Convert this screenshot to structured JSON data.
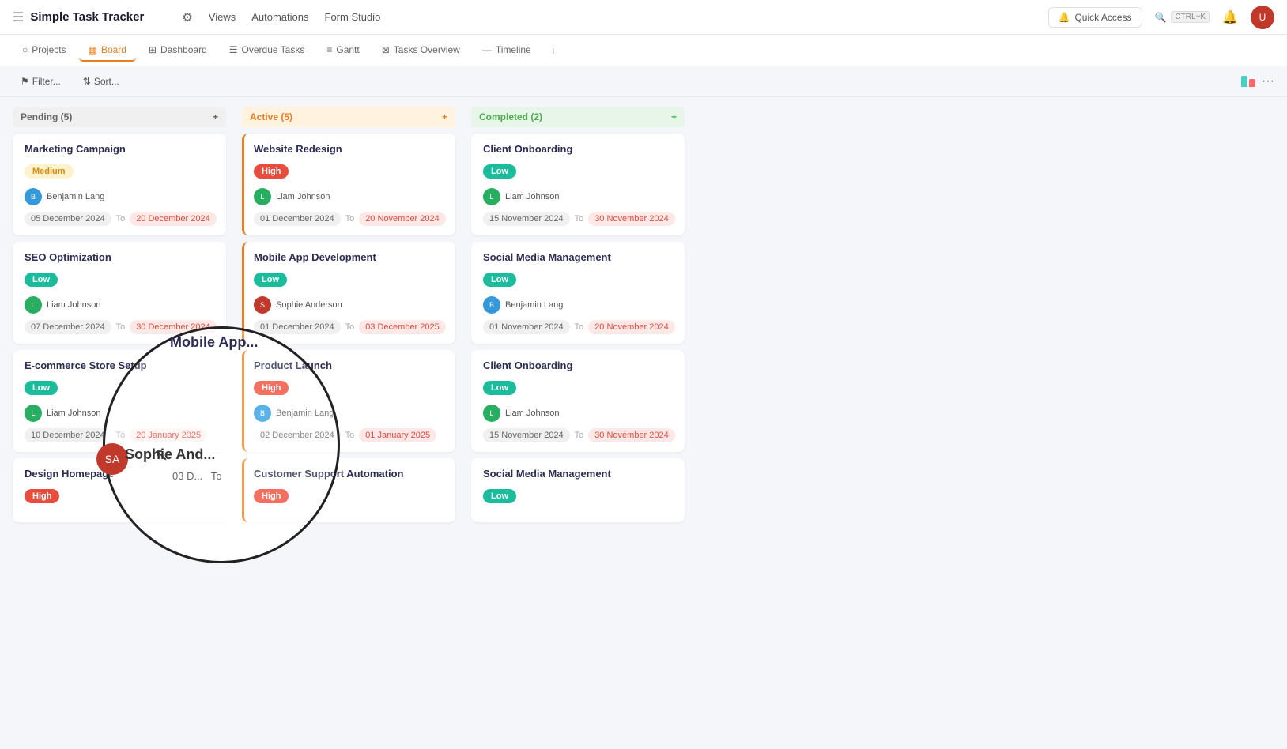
{
  "app": {
    "title": "Simple Task Tracker",
    "menu_icon": "☰"
  },
  "navbar": {
    "settings_icon": "⚙",
    "views_label": "Views",
    "automations_label": "Automations",
    "form_studio_label": "Form Studio",
    "quick_access_label": "Quick Access",
    "search_shortcut": "CTRL+K",
    "search_icon": "🔍",
    "notif_icon": "🔔"
  },
  "sub_nav": {
    "items": [
      {
        "icon": "○",
        "label": "Projects"
      },
      {
        "icon": "▦",
        "label": "Board",
        "active": true
      },
      {
        "icon": "⊞",
        "label": "Dashboard"
      },
      {
        "icon": "☰",
        "label": "Overdue Tasks"
      },
      {
        "icon": "≡",
        "label": "Gantt"
      },
      {
        "icon": "⊠",
        "label": "Tasks Overview"
      },
      {
        "icon": "—",
        "label": "Timeline"
      }
    ]
  },
  "toolbar": {
    "filter_label": "Filter...",
    "sort_label": "Sort..."
  },
  "columns": [
    {
      "id": "pending",
      "label": "Pending",
      "count": 5,
      "type": "pending",
      "cards": [
        {
          "title": "Marketing Campaign",
          "badge": "Medium",
          "badge_type": "medium",
          "assignee": "Benjamin Lang",
          "avatar_color": "av-blue",
          "date_from": "05 December 2024",
          "date_to": "20 December 2024",
          "active_border": false
        },
        {
          "title": "SEO Optimization",
          "badge": "Low",
          "badge_type": "low",
          "assignee": "Liam Johnson",
          "avatar_color": "av-green",
          "date_from": "07 December 2024",
          "date_to": "30 December 2024",
          "active_border": false
        },
        {
          "title": "E-commerce Store Setup",
          "badge": "Low",
          "badge_type": "low",
          "assignee": "Liam Johnson",
          "avatar_color": "av-green",
          "date_from": "10 December 2024",
          "date_to": "20 January 2025",
          "active_border": false
        },
        {
          "title": "Design Homepage",
          "badge": "High",
          "badge_type": "high",
          "assignee": "",
          "avatar_color": "",
          "date_from": "",
          "date_to": "",
          "active_border": false
        }
      ]
    },
    {
      "id": "active",
      "label": "Active",
      "count": 5,
      "type": "active",
      "cards": [
        {
          "title": "Website Redesign",
          "badge": "High",
          "badge_type": "high",
          "assignee": "Liam Johnson",
          "avatar_color": "av-green",
          "date_from": "01 December 2024",
          "date_to": "20 November 2024",
          "active_border": true
        },
        {
          "title": "Mobile App Development",
          "badge": "Low",
          "badge_type": "low",
          "assignee": "Sophie Anderson",
          "avatar_color": "av-red",
          "date_from": "01 December 2024",
          "date_to": "03 December 2025",
          "active_border": true
        },
        {
          "title": "Product Launch",
          "badge": "High",
          "badge_type": "high",
          "assignee": "Benjamin Lang",
          "avatar_color": "av-blue",
          "date_from": "02 December 2024",
          "date_to": "01 January 2025",
          "active_border": true
        },
        {
          "title": "Customer Support Automation",
          "badge": "High",
          "badge_type": "high",
          "assignee": "",
          "avatar_color": "",
          "date_from": "",
          "date_to": "",
          "active_border": true
        }
      ]
    },
    {
      "id": "completed",
      "label": "Completed",
      "count": 2,
      "type": "completed",
      "cards": [
        {
          "title": "Client Onboarding",
          "badge": "Low",
          "badge_type": "low",
          "assignee": "Liam Johnson",
          "avatar_color": "av-green",
          "date_from": "15 November 2024",
          "date_to": "30 November 2024",
          "active_border": false
        },
        {
          "title": "Social Media Management",
          "badge": "Low",
          "badge_type": "low",
          "assignee": "Benjamin Lang",
          "avatar_color": "av-blue",
          "date_from": "01 November 2024",
          "date_to": "20 November 2024",
          "active_border": false
        },
        {
          "title": "Client Onboarding",
          "badge": "Low",
          "badge_type": "low",
          "assignee": "Liam Johnson",
          "avatar_color": "av-green",
          "date_from": "15 November 2024",
          "date_to": "30 November 2024",
          "active_border": false
        },
        {
          "title": "Social Media Management",
          "badge": "Low",
          "badge_type": "low",
          "assignee": "",
          "avatar_color": "",
          "date_from": "",
          "date_to": "",
          "active_border": false
        }
      ]
    }
  ],
  "magnifier": {
    "visible": true,
    "card_title": "Mobile App",
    "assignee_name": "Sophie And...",
    "date_from": "01 Dec 2024",
    "date_to": "03 D...",
    "to_label": "To"
  }
}
